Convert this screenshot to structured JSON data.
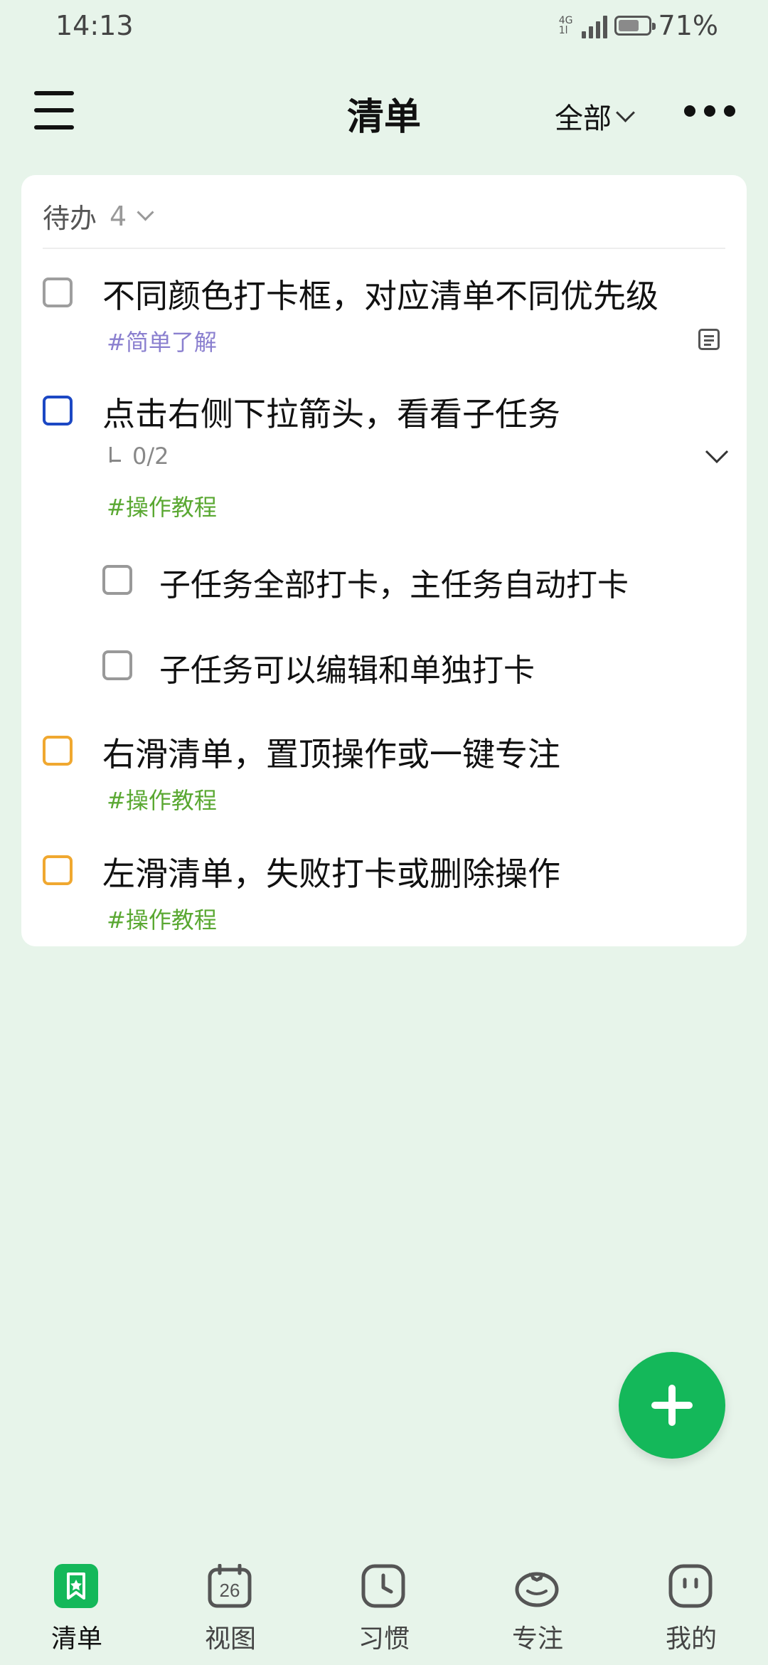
{
  "status_bar": {
    "time": "14:13",
    "network_top": "4G",
    "network_bottom": "1l",
    "battery": "71%",
    "battery_level": 0.71
  },
  "header": {
    "title": "清单",
    "filter_label": "全部"
  },
  "group": {
    "label": "待办",
    "count": "4"
  },
  "tasks": [
    {
      "title": "不同颜色打卡框，对应清单不同优先级",
      "tag": "#简单了解",
      "tag_color": "#8a7fcf",
      "checkbox_color": "#9e9e9e"
    },
    {
      "title": "点击右侧下拉箭头，看看子任务",
      "subtasks_count": "0/2",
      "tag": "#操作教程",
      "tag_color": "#5aa832",
      "checkbox_color": "#1c48c4",
      "subtasks": [
        {
          "title": "子任务全部打卡，主任务自动打卡"
        },
        {
          "title": "子任务可以编辑和单独打卡"
        }
      ]
    },
    {
      "title": "右滑清单，置顶操作或一键专注",
      "tag": "#操作教程",
      "tag_color": "#5aa832",
      "checkbox_color": "#f0a830"
    },
    {
      "title": "左滑清单，失败打卡或删除操作",
      "tag": "#操作教程",
      "tag_color": "#5aa832",
      "checkbox_color": "#f0a830"
    }
  ],
  "nav": {
    "items": [
      {
        "label": "清单",
        "icon": "checklist-icon"
      },
      {
        "label": "视图",
        "icon": "calendar-icon",
        "icon_text": "26"
      },
      {
        "label": "习惯",
        "icon": "clock-icon"
      },
      {
        "label": "专注",
        "icon": "tomato-icon"
      },
      {
        "label": "我的",
        "icon": "profile-icon"
      }
    ],
    "active_color": "#14b85a"
  }
}
